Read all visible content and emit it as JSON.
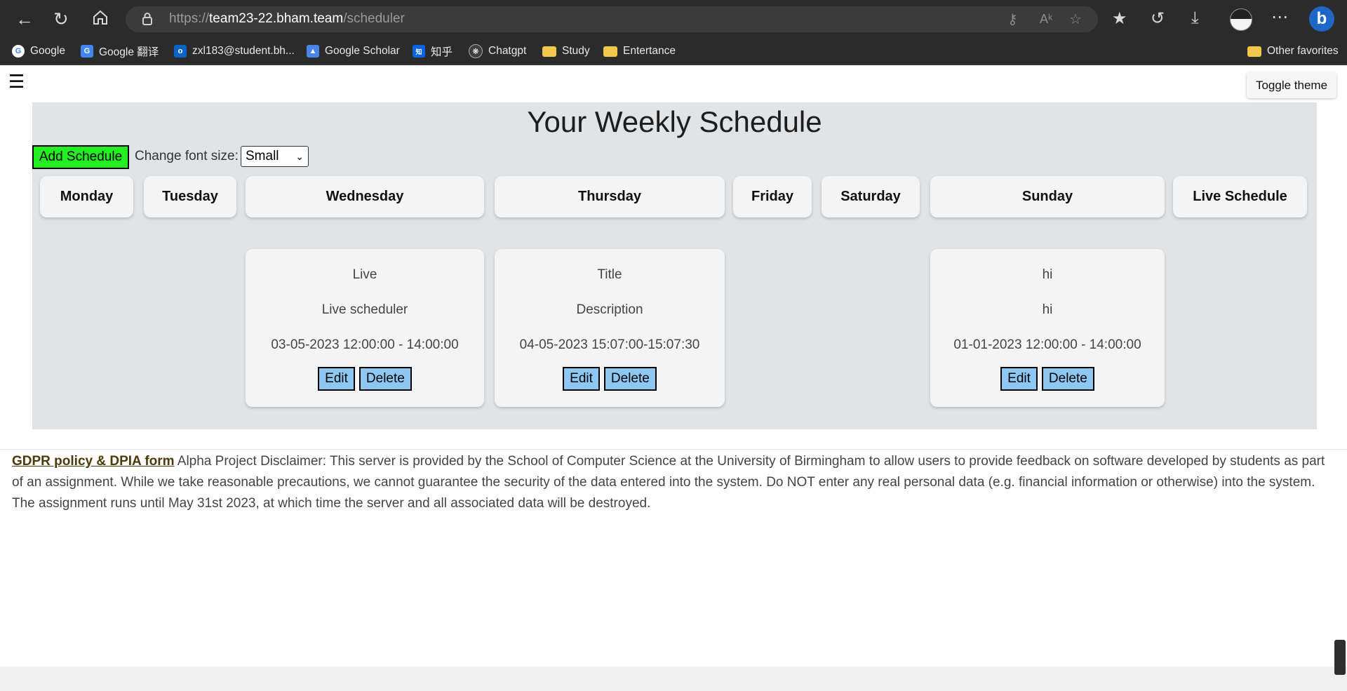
{
  "browser": {
    "url_scheme": "https://",
    "url_host": "team23-22.bham.team",
    "url_path": "/scheduler",
    "bookmarks": [
      {
        "label": "Google",
        "icon": "google-icon"
      },
      {
        "label": "Google 翻译",
        "icon": "google-translate-icon"
      },
      {
        "label": "zxl183@student.bh...",
        "icon": "outlook-icon"
      },
      {
        "label": "Google Scholar",
        "icon": "scholar-icon"
      },
      {
        "label": "知乎",
        "icon": "zhihu-icon"
      },
      {
        "label": "Chatgpt",
        "icon": "chatgpt-icon"
      },
      {
        "label": "Study",
        "icon": "folder-icon"
      },
      {
        "label": "Entertance",
        "icon": "folder-icon"
      }
    ],
    "other_favorites": "Other favorites"
  },
  "page": {
    "toggle_theme": "Toggle theme",
    "title": "Your Weekly Schedule",
    "add_schedule": "Add Schedule",
    "font_size_label": "Change font size:",
    "font_size_value": "Small",
    "days": [
      "Monday",
      "Tuesday",
      "Wednesday",
      "Thursday",
      "Friday",
      "Saturday",
      "Sunday",
      "Live Schedule"
    ],
    "cards": [
      {
        "day": "Wednesday",
        "title": "Live",
        "description": "Live scheduler",
        "time": "03-05-2023 12:00:00 - 14:00:00",
        "edit": "Edit",
        "delete": "Delete"
      },
      {
        "day": "Thursday",
        "title": "Title",
        "description": "Description",
        "time": "04-05-2023 15:07:00-15:07:30",
        "edit": "Edit",
        "delete": "Delete"
      },
      {
        "day": "Sunday",
        "title": "hi",
        "description": "hi",
        "time": "01-01-2023 12:00:00 - 14:00:00",
        "edit": "Edit",
        "delete": "Delete"
      }
    ],
    "footer": {
      "link": "GDPR policy & DPIA form",
      "text": "Alpha Project Disclaimer: This server is provided by the School of Computer Science at the University of Birmingham to allow users to provide feedback on software developed by students as part of an assignment. While we take reasonable precautions, we cannot guarantee the security of the data entered into the system. Do NOT enter any real personal data (e.g. financial information or otherwise) into the system. The assignment runs until May 31st 2023, at which time the server and all associated data will be destroyed."
    }
  },
  "colors": {
    "add_button": "#22ee22",
    "card_button": "#8cc8f2",
    "panel": "#e2e3e5",
    "chrome": "#2b2b2b"
  }
}
